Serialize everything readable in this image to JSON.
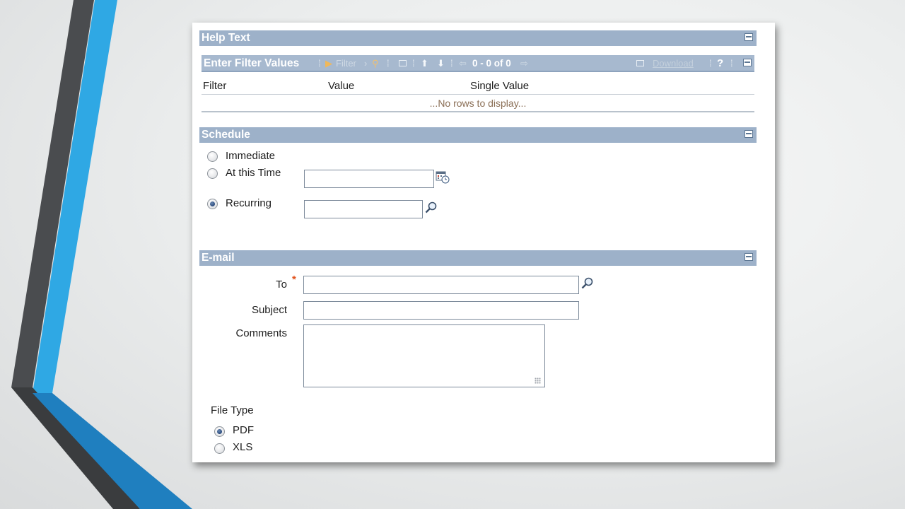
{
  "sections": {
    "help_text": {
      "title": "Help Text"
    },
    "filter": {
      "title": "Enter Filter Values",
      "toolbar": {
        "filter_label": "Filter",
        "count": "0 - 0 of 0",
        "download_label": "Download",
        "help_label": "?"
      },
      "columns": [
        "Filter",
        "Value",
        "Single Value"
      ],
      "empty_message": "...No rows to display..."
    },
    "schedule": {
      "title": "Schedule",
      "options": [
        {
          "label": "Immediate",
          "selected": false
        },
        {
          "label": "At this Time",
          "selected": false
        },
        {
          "label": "Recurring",
          "selected": true
        }
      ],
      "time_value": "",
      "recurring_value": ""
    },
    "email": {
      "title": "E-mail",
      "to_label": "To",
      "required_mark": "*",
      "subject_label": "Subject",
      "comments_label": "Comments",
      "to_value": "",
      "subject_value": "",
      "comments_value": "",
      "file_type_label": "File Type",
      "file_types": [
        {
          "label": "PDF",
          "selected": true
        },
        {
          "label": "XLS",
          "selected": false
        }
      ]
    }
  },
  "colors": {
    "section_header": "#9db1c9",
    "deco_dark": "#3f4245",
    "deco_blue": "#2fa8e4",
    "deco_blue_dark": "#1f7fbf",
    "required": "#e2551f"
  },
  "icons": [
    "calendar-clock-icon",
    "search-icon",
    "collapse-icon",
    "download-icon",
    "binoculars-icon"
  ]
}
